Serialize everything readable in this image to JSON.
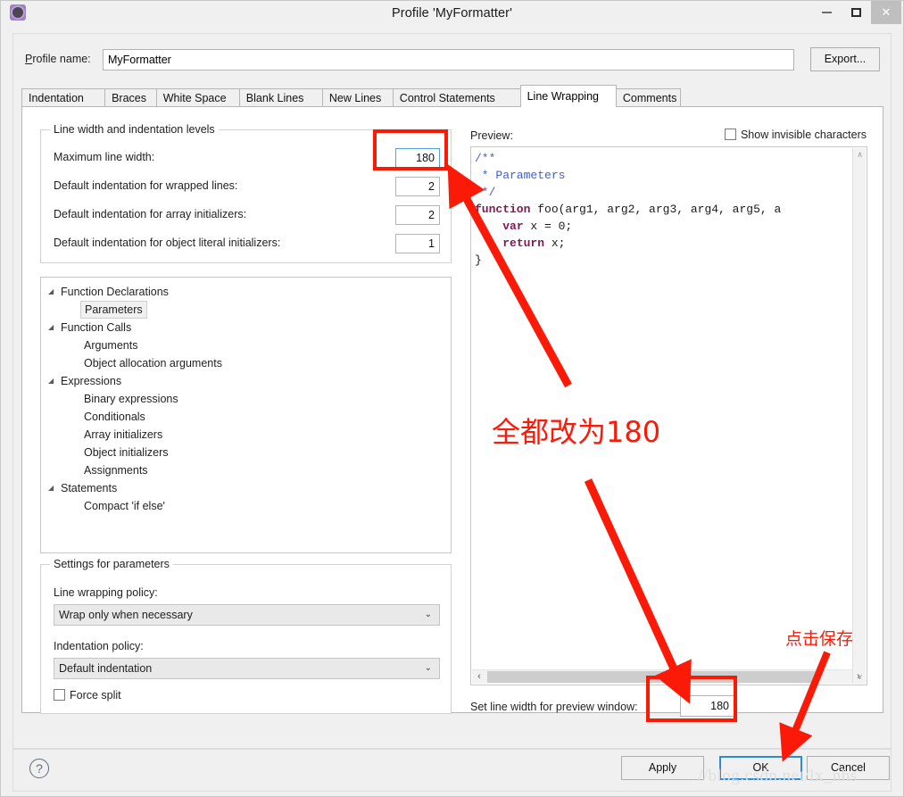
{
  "window": {
    "title": "Profile 'MyFormatter'",
    "icon": "settings-gear-icon",
    "minimize_label": "–",
    "maximize_label": "□",
    "close_label": "✕"
  },
  "profile": {
    "label_prefix": "P",
    "label_rest": "rofile name:",
    "value": "MyFormatter",
    "export_label": "Export..."
  },
  "tabs": [
    {
      "label": "Indentation",
      "active": false
    },
    {
      "label": "Braces",
      "active": false
    },
    {
      "label": "White Space",
      "active": false
    },
    {
      "label": "Blank Lines",
      "active": false
    },
    {
      "label": "New Lines",
      "active": false
    },
    {
      "label": "Control Statements",
      "active": false
    },
    {
      "label": "Line Wrapping",
      "active": true
    },
    {
      "label": "Comments",
      "active": false
    }
  ],
  "line_width_group": {
    "legend": "Line width and indentation levels",
    "rows": [
      {
        "label": "Maximum line width:",
        "value": "180",
        "focused": true
      },
      {
        "label": "Default indentation for wrapped lines:",
        "value": "2",
        "focused": false
      },
      {
        "label": "Default indentation for array initializers:",
        "value": "2",
        "focused": false
      },
      {
        "label": "Default indentation for object literal initializers:",
        "value": "1",
        "focused": false
      }
    ]
  },
  "tree": {
    "items": [
      {
        "label": "Function Declarations",
        "level": 0,
        "expandable": true,
        "selected": false
      },
      {
        "label": "Parameters",
        "level": 1,
        "expandable": false,
        "selected": true
      },
      {
        "label": "Function Calls",
        "level": 0,
        "expandable": true,
        "selected": false
      },
      {
        "label": "Arguments",
        "level": 1,
        "expandable": false,
        "selected": false
      },
      {
        "label": "Object allocation arguments",
        "level": 1,
        "expandable": false,
        "selected": false
      },
      {
        "label": "Expressions",
        "level": 0,
        "expandable": true,
        "selected": false
      },
      {
        "label": "Binary expressions",
        "level": 1,
        "expandable": false,
        "selected": false
      },
      {
        "label": "Conditionals",
        "level": 1,
        "expandable": false,
        "selected": false
      },
      {
        "label": "Array initializers",
        "level": 1,
        "expandable": false,
        "selected": false
      },
      {
        "label": "Object initializers",
        "level": 1,
        "expandable": false,
        "selected": false
      },
      {
        "label": "Assignments",
        "level": 1,
        "expandable": false,
        "selected": false
      },
      {
        "label": "Statements",
        "level": 0,
        "expandable": true,
        "selected": false
      },
      {
        "label": "Compact 'if else'",
        "level": 1,
        "expandable": false,
        "selected": false
      }
    ],
    "twisty_glyph": "◢"
  },
  "settings_group": {
    "legend": "Settings for parameters",
    "wrapping_policy_label": "Line wrapping policy:",
    "wrapping_policy_value": "Wrap only when necessary",
    "indentation_policy_label": "Indentation policy:",
    "indentation_policy_value": "Default indentation",
    "force_split_label": "Force split",
    "force_split_checked": false,
    "dropdown_arrow": "⌄"
  },
  "preview": {
    "label": "Preview:",
    "show_invisible_label": "Show invisible characters",
    "show_invisible_checked": false,
    "code_lines": [
      {
        "segments": [
          {
            "t": "/**",
            "c": "cmt"
          }
        ]
      },
      {
        "segments": [
          {
            "t": " * Parameters",
            "c": "cmt"
          }
        ]
      },
      {
        "segments": [
          {
            "t": " */",
            "c": "cmt"
          }
        ]
      },
      {
        "segments": [
          {
            "t": "function",
            "c": "kw"
          },
          {
            "t": " foo(arg1, arg2, arg3, arg4, arg5, a",
            "c": "pln"
          }
        ]
      },
      {
        "segments": [
          {
            "t": "    ",
            "c": "pln"
          },
          {
            "t": "var",
            "c": "kw"
          },
          {
            "t": " x = 0;",
            "c": "pln"
          }
        ]
      },
      {
        "segments": [
          {
            "t": "    ",
            "c": "pln"
          },
          {
            "t": "return",
            "c": "kw"
          },
          {
            "t": " x;",
            "c": "pln"
          }
        ]
      },
      {
        "segments": [
          {
            "t": "}",
            "c": "pln"
          }
        ]
      }
    ],
    "scroll_up_glyph": "∧",
    "scroll_down_glyph": "∨",
    "scroll_left_glyph": "‹",
    "scroll_right_glyph": "›",
    "set_width_label": "Set line width for preview window:",
    "set_width_value": "180"
  },
  "footer": {
    "help_glyph": "?",
    "apply_label": "Apply",
    "ok_label": "OK",
    "cancel_label": "Cancel"
  },
  "annotations": {
    "change_all_to_180": "全都改为180",
    "click_save": "点击保存",
    "highlight_color": "#f91a04",
    "arrow_color": "#fb1a08"
  },
  "watermark": "//blog.csdn.net/lx_nhs"
}
